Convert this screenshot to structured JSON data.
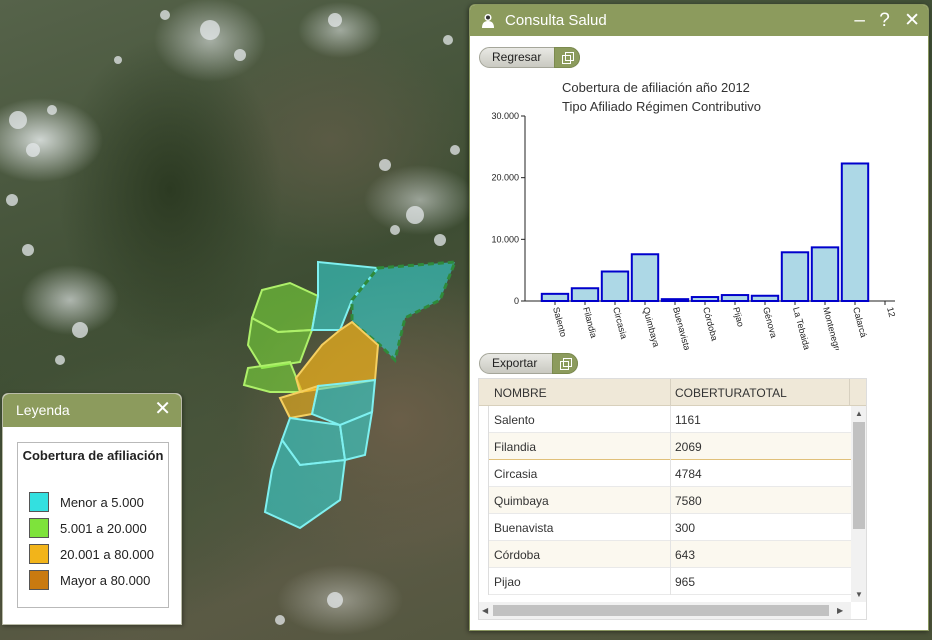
{
  "legend": {
    "title": "Leyenda",
    "close": "✕",
    "heading": "Cobertura de afiliación",
    "items": [
      {
        "label": "Menor a 5.000",
        "color": "#33e0e0"
      },
      {
        "label": "5.001 a 20.000",
        "color": "#7ee33b"
      },
      {
        "label": "20.001 a 80.000",
        "color": "#f2b41a"
      },
      {
        "label": "Mayor a 80.000",
        "color": "#c97a10"
      }
    ]
  },
  "panel": {
    "title": "Consulta Salud",
    "minimize": "–",
    "help": "?",
    "close": "✕",
    "back_button": "Regresar",
    "export_button": "Exportar"
  },
  "chart_data": {
    "type": "bar",
    "title": "Cobertura de afiliación año 2012",
    "subtitle": "Tipo Afiliado Régimen Contributivo",
    "categories": [
      "Salento",
      "Filandia",
      "Circasia",
      "Quimbaya",
      "Buenavista",
      "Córdoba",
      "Pijao",
      "Génova",
      "La Tebaida",
      "Montenegro",
      "Calarcá"
    ],
    "values": [
      1161,
      2069,
      4784,
      7580,
      300,
      643,
      965,
      850,
      7900,
      8700,
      22300
    ],
    "yticks": [
      "0",
      "10.000",
      "20.000",
      "30.000"
    ],
    "ylim": [
      0,
      30000
    ],
    "x_end_label": "12",
    "bar_color": "#add8e6",
    "bar_stroke": "#0000cc"
  },
  "table": {
    "columns": [
      "NOMBRE",
      "COBERTURATOTAL"
    ],
    "rows": [
      [
        "Salento",
        "1161"
      ],
      [
        "Filandia",
        "2069"
      ],
      [
        "Circasia",
        "4784"
      ],
      [
        "Quimbaya",
        "7580"
      ],
      [
        "Buenavista",
        "300"
      ],
      [
        "Córdoba",
        "643"
      ],
      [
        "Pijao",
        "965"
      ]
    ]
  }
}
